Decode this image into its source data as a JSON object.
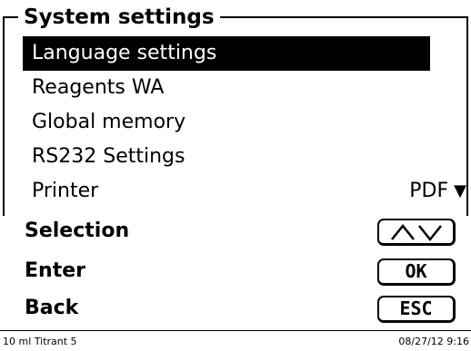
{
  "window": {
    "title": "System settings"
  },
  "menu": {
    "items": [
      {
        "label": "Language settings"
      },
      {
        "label": "Reagents WA"
      },
      {
        "label": "Global memory"
      },
      {
        "label": "RS232 Settings"
      },
      {
        "label": "Printer",
        "value": "PDF",
        "icon": "dropdown-triangle-icon"
      }
    ],
    "selected_index": 0
  },
  "softkeys": {
    "selection": {
      "label": "Selection",
      "icon": "up-down-arrows-icon"
    },
    "enter": {
      "label": "Enter",
      "key": "OK"
    },
    "back": {
      "label": "Back",
      "key": "ESC"
    }
  },
  "statusbar": {
    "left": "10 ml Titrant 5",
    "right": "08/27/12 9:16"
  }
}
